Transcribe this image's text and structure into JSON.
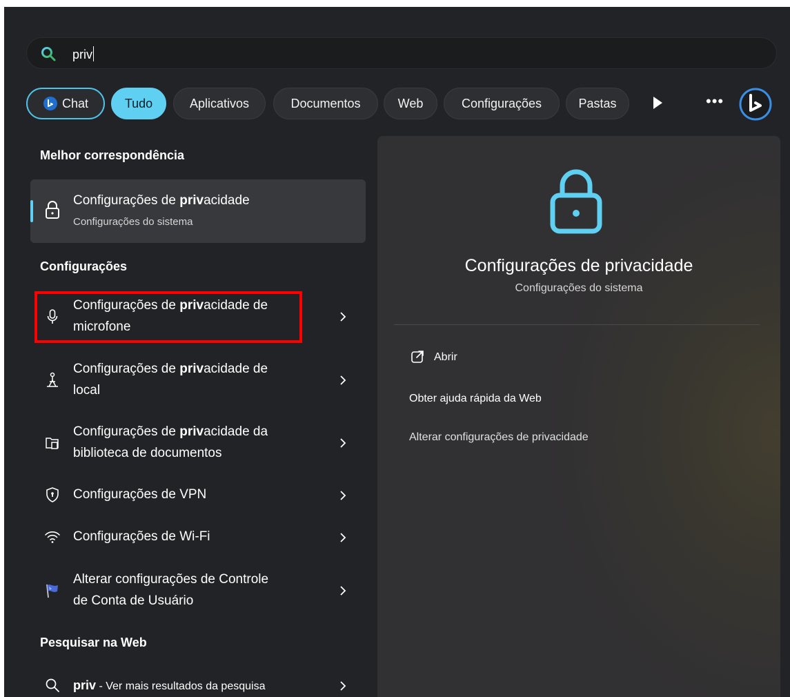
{
  "search": {
    "query": "priv"
  },
  "chips": {
    "chat": "Chat",
    "tudo": "Tudo",
    "aplicativos": "Aplicativos",
    "documentos": "Documentos",
    "web": "Web",
    "configuracoes": "Configurações",
    "pastas": "Pastas"
  },
  "best_match": {
    "heading": "Melhor correspondência",
    "title_pre": "Configurações de ",
    "title_bold": "priv",
    "title_post": "acidade",
    "subtitle": "Configurações do sistema"
  },
  "settings": {
    "heading": "Configurações",
    "items": [
      {
        "pre": "Configurações de ",
        "bold": "priv",
        "post": "acidade de",
        "line2": "microfone",
        "icon": "microphone-icon"
      },
      {
        "pre": "Configurações de ",
        "bold": "priv",
        "post": "acidade de",
        "line2": "local",
        "icon": "location-person-icon"
      },
      {
        "pre": "Configurações de ",
        "bold": "priv",
        "post": "acidade da",
        "line2": "biblioteca de documentos",
        "icon": "document-library-icon"
      },
      {
        "pre": "Configurações de VPN",
        "bold": "",
        "post": "",
        "line2": "",
        "icon": "shield-icon"
      },
      {
        "pre": "Configurações de Wi-Fi",
        "bold": "",
        "post": "",
        "line2": "",
        "icon": "wifi-icon"
      },
      {
        "pre": "Alterar configurações de Controle",
        "bold": "",
        "post": "",
        "line2": "de Conta de Usuário",
        "icon": "uac-flag-icon"
      }
    ]
  },
  "web_search": {
    "heading": "Pesquisar na Web",
    "query": "priv",
    "suffix": " - Ver mais resultados da pesquisa"
  },
  "preview": {
    "title": "Configurações de privacidade",
    "subtitle": "Configurações do sistema",
    "actions": {
      "open": "Abrir",
      "quick_help": "Obter ajuda rápida da Web",
      "change": "Alterar configurações de privacidade"
    }
  },
  "colors": {
    "accent": "#5fd0f2",
    "highlight": "#ff0000",
    "background": "#222326"
  }
}
